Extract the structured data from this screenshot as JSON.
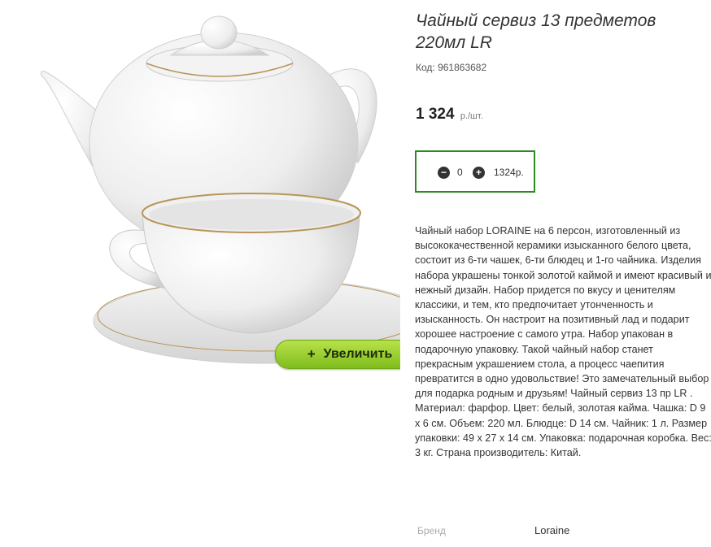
{
  "product": {
    "title": "Чайный сервиз 13 предметов 220мл LR",
    "code": "Код: 961863682",
    "price": "1 324",
    "price_unit": "р./шт.",
    "image_alt": "Чайный сервиз 13 предметов 220мл LR"
  },
  "zoom": {
    "icon": "+",
    "label": "Увеличить"
  },
  "quantity": {
    "minus": "−",
    "value": "0",
    "plus": "+",
    "total": "1324р."
  },
  "description": "Чайный набор LORAINE на 6 персон, изготовленный из высококачественной керамики изысканного белого цвета, состоит из 6-ти чашек, 6-ти блюдец и 1-го чайника. Изделия набора украшены тонкой золотой каймой и имеют красивый и нежный дизайн. Набор придется по вкусу и ценителям классики, и тем, кто предпочитает утонченность и изысканность. Он настроит на позитивный лад и подарит хорошее настроение с самого утра. Набор упакован в подарочную упаковку. Такой чайный набор станет прекрасным украшением стола, а процесс чаепития превратится в одно удовольствие! Это замечательный выбор для подарка родным и друзьям! Чайный сервиз 13 пр LR . Материал: фарфор. Цвет: белый, золотая кайма. Чашка: D 9 х 6 см. Объем: 220 мл. Блюдце: D 14 см. Чайник: 1 л. Размер упаковки: 49 х 27 х 14 см. Упаковка: подарочная коробка. Вес: 3 кг. Страна производитель: Китай.",
  "specs": {
    "brand_label": "Бренд",
    "brand_value": "Loraine"
  },
  "colors": {
    "accent_green": "#2c8a1e",
    "button_green": "#8fca2a",
    "gold_rim": "#b8955a"
  }
}
